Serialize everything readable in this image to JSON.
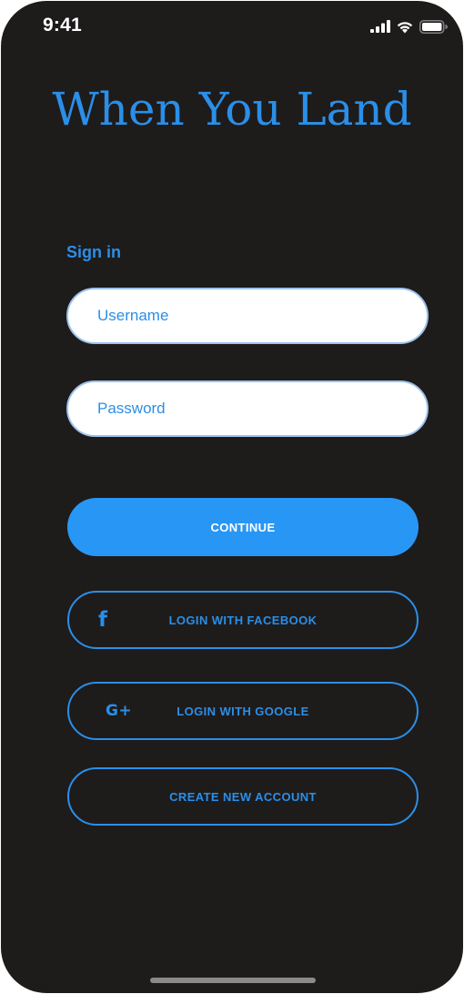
{
  "status_bar": {
    "time": "9:41"
  },
  "app": {
    "title": "When You Land"
  },
  "signin": {
    "heading": "Sign in",
    "username_placeholder": "Username",
    "password_placeholder": "Password"
  },
  "buttons": {
    "continue_label": "CONTINUE",
    "facebook_label": "LOGIN WITH FACEBOOK",
    "facebook_icon_glyph": "f",
    "google_label": "LOGIN WITH GOOGLE",
    "google_icon_glyph": "G+",
    "create_account_label": "CREATE NEW ACCOUNT"
  },
  "colors": {
    "background": "#1e1b1b",
    "accent": "#2a8fe8",
    "primary_button": "#2896f5",
    "field_border": "#9cc2ea"
  },
  "icons": {
    "status": [
      "signal-icon",
      "wifi-icon",
      "battery-icon"
    ],
    "social": [
      "facebook-icon",
      "google-plus-icon"
    ]
  }
}
